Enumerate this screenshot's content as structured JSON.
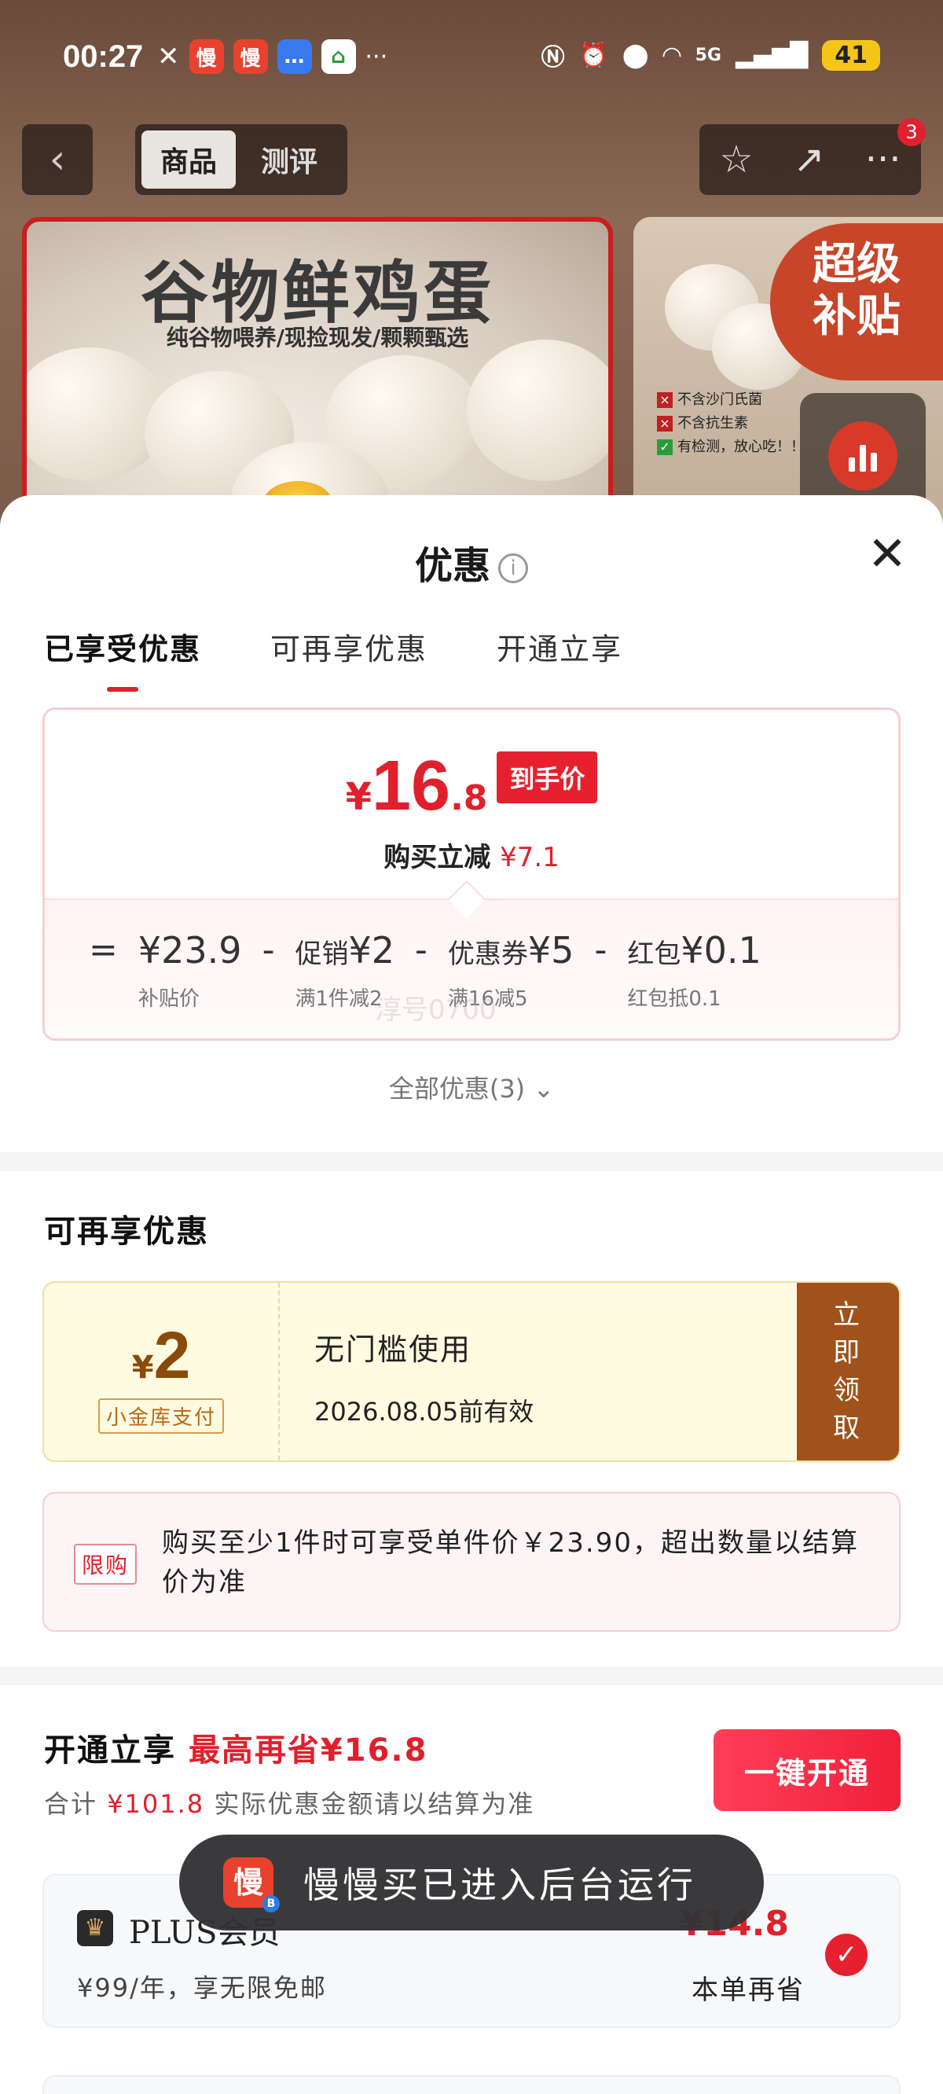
{
  "status_bar": {
    "time": "00:27",
    "network": "5G",
    "signal": "6",
    "battery": "41",
    "app_icons": [
      "慢",
      "慢"
    ]
  },
  "nav": {
    "tabs": [
      "商品",
      "测评"
    ],
    "active_tab": "商品",
    "badge": "3"
  },
  "banner": {
    "title": "谷物鲜鸡蛋",
    "subtitle": "纯谷物喂养/现捡现发/颗颗甄选",
    "super_badge_line1": "超级",
    "super_badge_line2": "补贴",
    "side_items": [
      "不含沙门氏菌",
      "不含抗生素",
      "有检测，放心吃！！"
    ]
  },
  "sheet": {
    "title": "优惠",
    "info_icon": "i",
    "tabs": [
      "已享受优惠",
      "可再享优惠",
      "开通立享"
    ],
    "active_tab": "已享受优惠"
  },
  "price_card": {
    "yen": "¥",
    "int": "16",
    "dec": ".8",
    "tag": "到手价",
    "reduce_label": "购买立减",
    "reduce_amount": "¥7.1",
    "breakdown": [
      {
        "op": "=",
        "label": "",
        "value": "¥23.9",
        "sub": "补贴价"
      },
      {
        "op": "-",
        "label": "促销",
        "value": "¥2",
        "sub": "满1件减2"
      },
      {
        "op": "-",
        "label": "优惠券",
        "value": "¥5",
        "sub": "满16减5"
      },
      {
        "op": "-",
        "label": "红包",
        "value": "¥0.1",
        "sub": "红包抵0.1"
      }
    ],
    "watermark": "淳号0700"
  },
  "all_offers": "全部优惠(3)",
  "more_section": {
    "title": "可再享优惠",
    "coupon": {
      "yen": "¥",
      "amount": "2",
      "tag": "小金库支付",
      "condition": "无门槛使用",
      "expiry": "2026.08.05前有效",
      "button": "立即领取"
    },
    "limit": {
      "tag": "限购",
      "text": "购买至少1件时可享受单件价￥23.90，超出数量以结算价为准"
    }
  },
  "open_section": {
    "title": "开通立享",
    "highlight": "最高再省¥16.8",
    "sub_prefix": "合计",
    "sub_amount": "¥101.8",
    "sub_suffix": "实际优惠金额请以结算为准",
    "button": "一键开通",
    "plus": {
      "name": "PLUS会员",
      "desc": "¥99/年，享无限免邮",
      "save": "¥14.8",
      "save_label": "本单再省"
    }
  },
  "toast": {
    "icon": "慢",
    "text": "慢慢买已进入后台运行"
  },
  "colors": {
    "accent_red": "#e0202c",
    "coupon_brown": "#a0521a",
    "coupon_bg": "#fffbe0"
  }
}
